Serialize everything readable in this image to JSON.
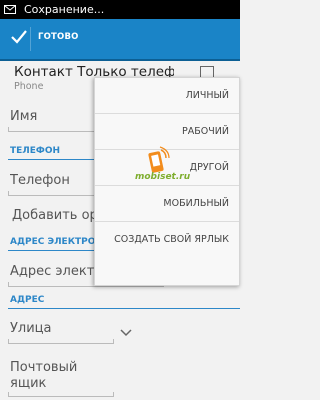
{
  "statusbar": {
    "notification": "Сохранение..."
  },
  "actionbar": {
    "done_label": "ГОТОВО"
  },
  "account": {
    "name": "Контакт Только телеф",
    "type": "Phone"
  },
  "fields": {
    "name_placeholder": "Имя",
    "phone_placeholder": "Телефон",
    "add_org": "Добавить ор",
    "email_placeholder": "Адрес электронног",
    "email_type": "ЛИЧНЫЙ",
    "street_placeholder": "Улица",
    "pobox_placeholder_1": "Почтовый",
    "pobox_placeholder_2": "ящик"
  },
  "sections": {
    "phone": "ТЕЛЕФОН",
    "email": "АДРЕС ЭЛЕКТРО",
    "address": "АДРЕС"
  },
  "popup_menu": {
    "items": [
      "ЛИЧНЫЙ",
      "РАБОЧИЙ",
      "ДРУГОЙ",
      "МОБИЛЬНЫЙ",
      "СОЗДАТЬ СВОЙ ЯРЛЫК"
    ]
  },
  "watermark": {
    "text": "mobiset.ru"
  },
  "colors": {
    "accent": "#1a84c7",
    "section": "#2d87c8",
    "statusbar": "#000000"
  }
}
